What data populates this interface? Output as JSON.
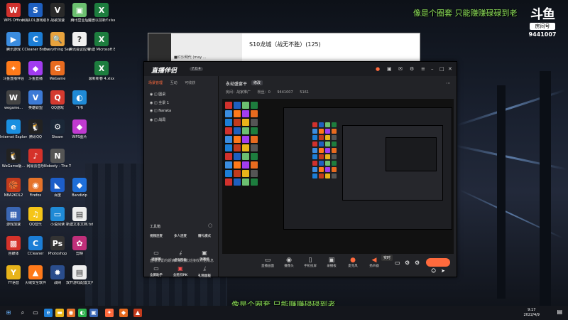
{
  "overlay": {
    "top_text": "像是个圈套 只能赚赚碌碌到老",
    "bottom_text": "像是个圈套 只能赚赚碌碌到老",
    "logo": "斗鱼",
    "room_tag": "房间号",
    "room_number": "9441007"
  },
  "desktop_icons": [
    {
      "label": "WPS Office",
      "glyph": "W",
      "color": "#d0312d"
    },
    {
      "label": "网易LOL游戏助手",
      "glyph": "S",
      "color": "#1e5fbf"
    },
    {
      "label": "战歌加速",
      "glyph": "V",
      "color": "#2a2a2a"
    },
    {
      "label": "腾讯营业后",
      "glyph": "▣",
      "color": "#6cc070"
    },
    {
      "label": "魔兽以前新Y.xlsx",
      "glyph": "X",
      "color": "#1d7d3e"
    },
    {
      "label": "腾讯游戏",
      "glyph": "▶",
      "color": "#3b8de0"
    },
    {
      "label": "CCleaner Browser",
      "glyph": "C",
      "color": "#1c7ed6"
    },
    {
      "label": "Everything Search",
      "glyph": "🔍",
      "color": "#e8a33d"
    },
    {
      "label": "腾讯会议应用",
      "glyph": "?",
      "color": "#f0f0f0"
    },
    {
      "label": "新建 Microsoft Excel...",
      "glyph": "X",
      "color": "#1d7d3e"
    },
    {
      "label": "斗鱼直播伴侣",
      "glyph": "✦",
      "color": "#ff7a1a"
    },
    {
      "label": "斗鱼直播",
      "glyph": "◆",
      "color": "#a23cf0"
    },
    {
      "label": "WeGame",
      "glyph": "G",
      "color": "#e86b1f"
    },
    {
      "label": "",
      "glyph": "",
      "color": "transparent"
    },
    {
      "label": "最新新春 4.xlsx",
      "glyph": "X",
      "color": "#1d7d3e"
    },
    {
      "label": "wegame...",
      "glyph": "W",
      "color": "#444"
    },
    {
      "label": "英雄联盟",
      "glyph": "V",
      "color": "#3c7ad6"
    },
    {
      "label": "QQ游戏",
      "glyph": "Q",
      "color": "#d43a2f"
    },
    {
      "label": "飞书",
      "glyph": "◐",
      "color": "#1f8ad6"
    },
    {
      "label": "",
      "glyph": "",
      "color": "transparent"
    },
    {
      "label": "Internet Explorer",
      "glyph": "e",
      "color": "#1a8fe0"
    },
    {
      "label": "腾讯QQ",
      "glyph": "🐧",
      "color": "#222"
    },
    {
      "label": "Steam",
      "glyph": "⚙",
      "color": "#1b2838"
    },
    {
      "label": "WPS图片",
      "glyph": "◆",
      "color": "#c03ad0"
    },
    {
      "label": "",
      "glyph": "",
      "color": "transparent"
    },
    {
      "label": "WeGame版...",
      "glyph": "🐧",
      "color": "#222"
    },
    {
      "label": "网易云音乐",
      "glyph": "♪",
      "color": "#d5322a"
    },
    {
      "label": "Nobody - The Turna...",
      "glyph": "N",
      "color": "#555"
    },
    {
      "label": "",
      "glyph": "",
      "color": "transparent"
    },
    {
      "label": "",
      "glyph": "",
      "color": "transparent"
    },
    {
      "label": "NBA2KOL2",
      "glyph": "🏀",
      "color": "#c23b1d"
    },
    {
      "label": "Firefox",
      "glyph": "◉",
      "color": "#e5732a"
    },
    {
      "label": "百度",
      "glyph": "◣",
      "color": "#1d5ec9"
    },
    {
      "label": "Bandizip",
      "glyph": "◆",
      "color": "#1e6fd9"
    },
    {
      "label": "",
      "glyph": "",
      "color": "transparent"
    },
    {
      "label": "游戏加速",
      "glyph": "▦",
      "color": "#3a66b3"
    },
    {
      "label": "QQ音乐",
      "glyph": "♫",
      "color": "#f5c518"
    },
    {
      "label": "小说阅读",
      "glyph": "▭",
      "color": "#1f8ad6"
    },
    {
      "label": "新建文本文档.txt",
      "glyph": "▤",
      "color": "#eee"
    },
    {
      "label": "",
      "glyph": "",
      "color": "transparent"
    },
    {
      "label": "自媒体",
      "glyph": "▩",
      "color": "#d5322a"
    },
    {
      "label": "CCleaner",
      "glyph": "C",
      "color": "#1c7ed6"
    },
    {
      "label": "Photoshop",
      "glyph": "Ps",
      "color": "#333"
    },
    {
      "label": "剪映",
      "glyph": "✿",
      "color": "#c02f7a"
    },
    {
      "label": "",
      "glyph": "",
      "color": "transparent"
    },
    {
      "label": "YY语音",
      "glyph": "Y",
      "color": "#e8b41a"
    },
    {
      "label": "火绒安全软件",
      "glyph": "▲",
      "color": "#ff7a1a"
    },
    {
      "label": "战网",
      "glyph": "✹",
      "color": "#2a4d8c"
    },
    {
      "label": "双开游戏配置文件.txt",
      "glyph": "▤",
      "color": "#eee"
    }
  ],
  "chat_window": {
    "title": "S10龙城（战无不胜）(125)",
    "item": "■红沙网代 (may ..."
  },
  "assistant": {
    "app_name": "直播伴侣",
    "version": "7.0.4",
    "tabs": [
      "场景管理",
      "互动",
      "可收获"
    ],
    "scenes": [
      "圆桌",
      "全景 1",
      "Naraka",
      "战局"
    ],
    "tools_title": "工具箱",
    "tools": [
      [
        "视频连麦",
        "多人连麦",
        "赠礼模式"
      ],
      [
        "滤弹幕",
        "虚拟形象",
        "弹幕姬"
      ],
      [
        "全屏助手",
        "全民扫PK",
        "礼物面板"
      ],
      [
        "上车一起玩",
        "粉丝消费"
      ]
    ],
    "room_title": "永劫盛宴干",
    "room_badge": "修改",
    "stats": [
      "房间：战家推广",
      "粉丝：0",
      "9441007",
      "5161"
    ],
    "bottom_buttons": [
      "直播画面",
      "摄像头",
      "手机投屏",
      "录播板",
      "麦克风",
      "扬声器"
    ],
    "hint": "直播设置的朗读：您在此处接收对话消息",
    "voice_label": "实时"
  },
  "taskbar": {
    "time": "9:17",
    "date": "2022/4/9"
  }
}
